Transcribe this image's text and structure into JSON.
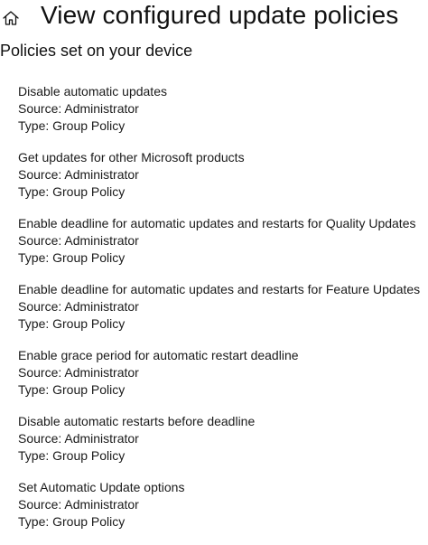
{
  "header": {
    "home_icon": "home-icon",
    "title": "View configured update policies"
  },
  "section": {
    "title": "Policies set on your device"
  },
  "policies": [
    {
      "name": "Disable automatic updates",
      "source": "Source: Administrator",
      "type": "Type: Group Policy"
    },
    {
      "name": "Get updates for other Microsoft products",
      "source": "Source: Administrator",
      "type": "Type: Group Policy"
    },
    {
      "name": "Enable deadline for automatic updates and restarts for Quality Updates",
      "source": "Source: Administrator",
      "type": "Type: Group Policy"
    },
    {
      "name": "Enable deadline for automatic updates and restarts for Feature Updates",
      "source": "Source: Administrator",
      "type": "Type: Group Policy"
    },
    {
      "name": "Enable grace period for automatic restart deadline",
      "source": "Source: Administrator",
      "type": "Type: Group Policy"
    },
    {
      "name": "Disable automatic restarts before deadline",
      "source": "Source: Administrator",
      "type": "Type: Group Policy"
    },
    {
      "name": "Set Automatic Update options",
      "source": "Source: Administrator",
      "type": "Type: Group Policy"
    }
  ]
}
